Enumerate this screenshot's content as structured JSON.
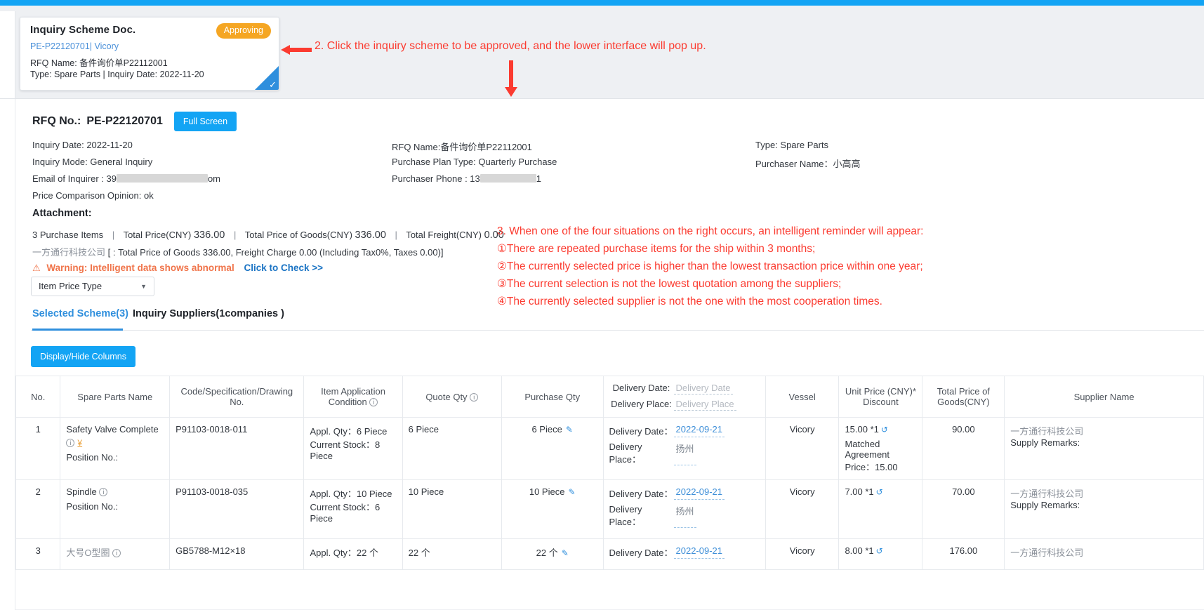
{
  "scheme_card": {
    "title": "Inquiry Scheme Doc.",
    "status_badge": "Approving",
    "code": "PE-P22120701",
    "separator": "| ",
    "vessel": "Vicory",
    "rfq_name_line": "RFQ Name: 备件询价单P22112001",
    "type_line": "Type:  Spare Parts  |  Inquiry Date:  2022-11-20",
    "check_glyph": "✓"
  },
  "annotations": {
    "step2": "2. Click the inquiry scheme to be approved, and the lower interface will pop up.",
    "step3_title": "3. When one of the four situations on the right occurs, an intelligent reminder will appear:",
    "step3_items": [
      "①There are repeated purchase items for the ship within 3 months;",
      "②The currently selected price is higher than the lowest transaction price within one year;",
      "③The current selection is not the lowest quotation among the suppliers;",
      "④The currently selected supplier is not the one with the most cooperation times."
    ]
  },
  "header": {
    "rfq_no_label": "RFQ No.:",
    "rfq_no_value": "PE-P22120701",
    "fullscreen_button": "Full Screen"
  },
  "meta": {
    "row1": {
      "c1": "Inquiry Date:  2022-11-20",
      "c2": "RFQ Name:备件询价单P22112001",
      "c3": "Type: Spare Parts"
    },
    "row2": {
      "c1": "Inquiry Mode: General Inquiry",
      "c2": "Purchase Plan Type: Quarterly Purchase",
      "c3": "Purchaser Name：小高高"
    },
    "row3": {
      "c1_prefix": "Email of Inquirer : 39",
      "c1_suffix": "om",
      "c2_prefix": "Purchaser Phone : 13",
      "c2_suffix": "1"
    },
    "row4": {
      "c1": "Price Comparison Opinion: ok"
    }
  },
  "attachment_label": "Attachment:",
  "totals": {
    "items_count": "3 Purchase Items",
    "total_price_label": "Total Price(CNY)",
    "total_price_value": "336.00",
    "total_goods_label": "Total Price of Goods(CNY)",
    "total_goods_value": "336.00",
    "total_freight_label": "Total Freight(CNY)",
    "total_freight_value": "0.00",
    "supplier_cn": "一方通行科技公司",
    "supplier_detail": "[ : Total Price of Goods 336.00, Freight Charge 0.00 (Including Tax0%, Taxes 0.00)]"
  },
  "warning": {
    "icon": "⚠",
    "text": "Warning: Intelligent data shows abnormal",
    "link": "Click to Check >>"
  },
  "price_type_select": {
    "value": "Item Price Type",
    "caret": "▼"
  },
  "tabs": [
    {
      "label": "Selected Scheme(3)",
      "active": true
    },
    {
      "label": "Inquiry Suppliers(1companies )",
      "active": false
    }
  ],
  "columns_button": "Display/Hide Columns",
  "table": {
    "headers": {
      "no": "No.",
      "spare_parts_name": "Spare Parts Name",
      "code_spec": "Code/Specification/Drawing No.",
      "item_application": "Item Application Condition",
      "quote_qty": "Quote Qty",
      "purchase_qty": "Purchase Qty",
      "delivery_date_label": "Delivery Date:",
      "delivery_date_placeholder": "Delivery Date",
      "delivery_place_label": "Delivery Place:",
      "delivery_place_placeholder": "Delivery Place",
      "vessel": "Vessel",
      "unit_price": "Unit Price (CNY)* Discount",
      "total_price_goods": "Total Price of Goods(CNY)",
      "supplier_name": "Supplier Name"
    },
    "rows": [
      {
        "no": "1",
        "name": "Safety Valve Complete",
        "position_label": "Position No.:",
        "code": "P91103-0018-011",
        "appl_qty": "Appl. Qty：6 Piece",
        "current_stock": "Current Stock：8 Piece",
        "quote_qty": "6 Piece",
        "purchase_qty": "6 Piece",
        "delivery_date_label": "Delivery Date：",
        "delivery_date": "2022-09-21",
        "delivery_place_label": "Delivery Place：",
        "delivery_place": "扬州",
        "vessel": "Vicory",
        "unit_price": "15.00 *1",
        "matched_price": "Matched Agreement Price：15.00",
        "total_price": "90.00",
        "supplier": "一方通行科技公司",
        "supply_remarks": "Supply Remarks:",
        "has_yen_icon": true
      },
      {
        "no": "2",
        "name": "Spindle",
        "position_label": "Position No.:",
        "code": "P91103-0018-035",
        "appl_qty": "Appl. Qty：10 Piece",
        "current_stock": "Current Stock：6 Piece",
        "quote_qty": "10 Piece",
        "purchase_qty": "10 Piece",
        "delivery_date_label": "Delivery Date：",
        "delivery_date": "2022-09-21",
        "delivery_place_label": "Delivery Place：",
        "delivery_place": "扬州",
        "vessel": "Vicory",
        "unit_price": "7.00 *1",
        "matched_price": "",
        "total_price": "70.00",
        "supplier": "一方通行科技公司",
        "supply_remarks": "Supply Remarks:",
        "has_yen_icon": false
      },
      {
        "no": "3",
        "name": "大号O型圈",
        "position_label": "",
        "code": "GB5788-M12×18",
        "appl_qty": "Appl. Qty：22 个",
        "current_stock": "",
        "quote_qty": "22 个",
        "purchase_qty": "22 个",
        "delivery_date_label": "Delivery Date：",
        "delivery_date": "2022-09-21",
        "delivery_place_label": "",
        "delivery_place": "",
        "vessel": "Vicory",
        "unit_price": "8.00 *1",
        "matched_price": "",
        "total_price": "176.00",
        "supplier": "一方通行科技公司",
        "supply_remarks": "",
        "has_yen_icon": false
      }
    ]
  }
}
